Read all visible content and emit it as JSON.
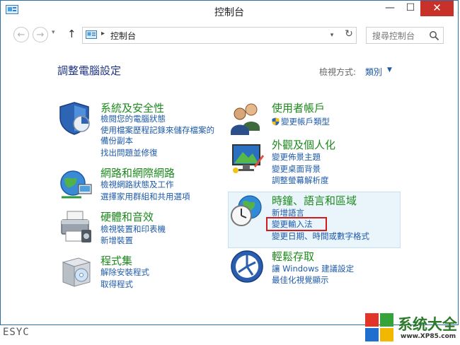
{
  "window": {
    "title": "控制台"
  },
  "titlebar_buttons": {
    "minimize": "—",
    "maximize": "☐",
    "close": "✕"
  },
  "navbar": {
    "back": "←",
    "forward": "→",
    "dropdown": "▾",
    "up": "↑",
    "separator": "▸",
    "address": "控制台",
    "address_dropdown": "▾",
    "refresh": "↻",
    "search_placeholder": "搜尋控制台"
  },
  "main": {
    "page_title": "調整電腦設定",
    "view_by_label": "檢視方式:",
    "view_by_value": "類別",
    "view_by_arrow": "▼"
  },
  "categories": [
    {
      "title": "系統及安全性",
      "links": [
        "檢閱您的電腦狀態",
        "使用檔案歷程記錄來儲存檔案的",
        "備份副本",
        "找出問題並修復"
      ]
    },
    {
      "title": "網路和網際網路",
      "links": [
        "檢視網路狀態及工作",
        "選擇家用群組和共用選項"
      ]
    },
    {
      "title": "硬體和音效",
      "links": [
        "檢視裝置和印表機",
        "新增裝置"
      ]
    },
    {
      "title": "程式集",
      "links": [
        "解除安裝程式",
        "取得程式"
      ]
    },
    {
      "title": "使用者帳戶",
      "links": [
        "變更帳戶類型"
      ]
    },
    {
      "title": "外觀及個人化",
      "links": [
        "變更佈景主題",
        "變更桌面背景",
        "調整螢幕解析度"
      ]
    },
    {
      "title": "時鐘、語言和區域",
      "links": [
        "新增語言",
        "變更輸入法",
        "變更日期、時間或數字格式"
      ]
    },
    {
      "title": "輕鬆存取",
      "links": [
        "讓 Windows 建議設定",
        "最佳化視覺顯示"
      ]
    }
  ],
  "watermark": {
    "left_text": "ESYC",
    "brand_name": "系统大全",
    "brand_url": "www.XP85.com"
  },
  "colors": {
    "title_green": "#1e8a1e",
    "link_blue": "#1e5aa8",
    "heading_blue": "#1e3287",
    "highlight_bg": "#eaf5fb",
    "annotation_red": "#d01c1c",
    "close_red": "#c7312a"
  }
}
